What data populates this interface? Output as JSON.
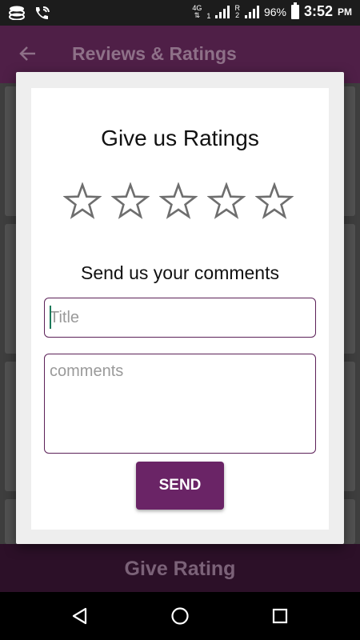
{
  "status_bar": {
    "network": "4G",
    "sim1": "1",
    "roaming": "R",
    "sim2": "2",
    "battery": "96%",
    "time": "3:52",
    "ampm": "PM"
  },
  "app_bar": {
    "title": "Reviews & Ratings",
    "back_icon": "arrow-left-icon"
  },
  "dialog": {
    "title": "Give us Ratings",
    "rating": {
      "value": 0,
      "max": 5
    },
    "comments_heading": "Send us your comments",
    "title_placeholder": "Title",
    "title_value": "",
    "comments_placeholder": "comments",
    "comments_value": "",
    "send_label": "SEND"
  },
  "bottom_bar": {
    "label": "Give Rating"
  },
  "nav_bar": {
    "icons": [
      "back-triangle-icon",
      "home-circle-icon",
      "recents-square-icon"
    ]
  },
  "colors": {
    "accent": "#6a2466",
    "app_bar": "#6b2a5f",
    "input_border": "#5c2158",
    "star_outline": "#6e6e6e"
  }
}
